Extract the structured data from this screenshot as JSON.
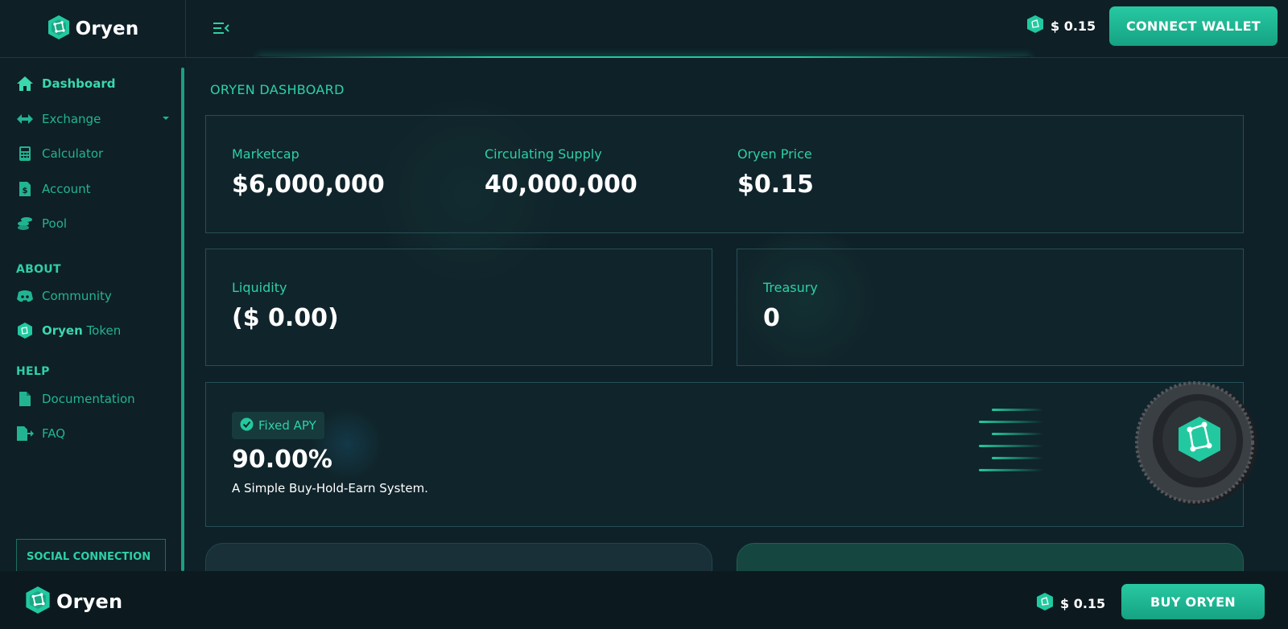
{
  "app": {
    "brand": "Oryen"
  },
  "header": {
    "price": "$ 0.15",
    "connect_label": "CONNECT WALLET"
  },
  "sidebar": {
    "items": [
      {
        "label": "Dashboard",
        "icon": "home-icon",
        "active": true
      },
      {
        "label": "Exchange",
        "icon": "exchange-arrows-icon",
        "has_dropdown": true
      },
      {
        "label": "Calculator",
        "icon": "calculator-icon"
      },
      {
        "label": "Account",
        "icon": "dollar-document-icon"
      },
      {
        "label": "Pool",
        "icon": "coin-stack-icon"
      }
    ],
    "about_title": "ABOUT",
    "about_items": [
      {
        "label": "Community",
        "icon": "discord-icon"
      },
      {
        "label_bold": "Oryen",
        "label_rest": "Token",
        "icon": "oryen-token-icon"
      }
    ],
    "help_title": "HELP",
    "help_items": [
      {
        "label": "Documentation",
        "icon": "document-icon"
      },
      {
        "label": "FAQ",
        "icon": "file-export-icon"
      }
    ],
    "social": {
      "title": "SOCIAL CONNECTION",
      "icons": [
        "twitter-icon",
        "medium-icon",
        "telegram-icon",
        "discord-icon"
      ]
    }
  },
  "main": {
    "page_title": "ORYEN DASHBOARD",
    "stats": [
      {
        "label": "Marketcap",
        "value": "$6,000,000"
      },
      {
        "label": "Circulating Supply",
        "value": "40,000,000"
      },
      {
        "label": "Oryen Price",
        "value": "$0.15"
      }
    ],
    "liquidity": {
      "label": "Liquidity",
      "value": "($ 0.00)"
    },
    "treasury": {
      "label": "Treasury",
      "value": "0"
    },
    "apy": {
      "badge": "Fixed APY",
      "value": "90.00%",
      "description": "A Simple Buy-Hold-Earn System."
    }
  },
  "footer": {
    "brand": "Oryen",
    "price": "$ 0.15",
    "buy_label": "BUY ORYEN"
  },
  "colors": {
    "accent": "#23c9a0",
    "background": "#0f2128",
    "text": "#ffffff"
  }
}
